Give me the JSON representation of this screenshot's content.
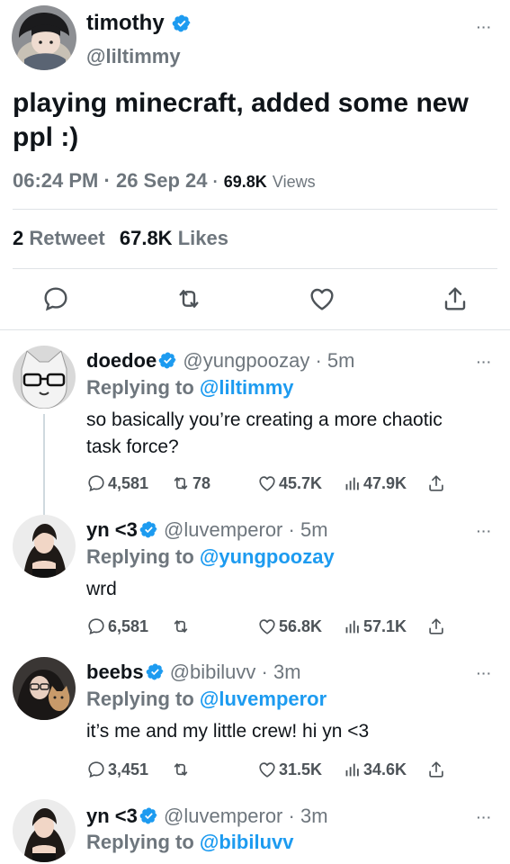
{
  "main_tweet": {
    "name": "timothy",
    "handle": "@liltimmy",
    "text": "playing minecraft, added some new ppl :)",
    "time": "06:24 PM",
    "separator": "·",
    "date": "26 Sep 24",
    "views_count": "69.8K",
    "views_label": "Views",
    "retweet_count": "2",
    "retweet_label": "Retweet",
    "like_count": "67.8K",
    "like_label": "Likes",
    "more_icon": "···"
  },
  "replies": [
    {
      "name": "doedoe",
      "handle": "@yungpoozay",
      "time": "· 5m",
      "replying_label": "Replying to",
      "replying_to": "@liltimmy",
      "text": "so basically you’re creating a more chaotic task force?",
      "comments": "4,581",
      "retweets": "78",
      "likes": "45.7K",
      "views": "47.9K"
    },
    {
      "name": "yn <3",
      "handle": "@luvemperor",
      "time": "· 5m",
      "replying_label": "Replying to",
      "replying_to": "@yungpoozay",
      "text": "wrd",
      "comments": "6,581",
      "retweets": "",
      "likes": "56.8K",
      "views": "57.1K"
    },
    {
      "name": "beebs",
      "handle": "@bibiluvv",
      "time": "· 3m",
      "replying_label": "Replying to",
      "replying_to": "@luvemperor",
      "text": "it’s me and my little crew! hi yn <3",
      "comments": "3,451",
      "retweets": "",
      "likes": "31.5K",
      "views": "34.6K"
    },
    {
      "name": "yn <3",
      "handle": "@luvemperor",
      "time": "· 3m",
      "replying_label": "Replying to",
      "replying_to": "@bibiluvv"
    }
  ],
  "colors": {
    "accent": "#1d9bf0",
    "secondary_text": "#6e767d",
    "divider": "#dfe3e6"
  },
  "icons": {
    "verified": "verified-badge-icon",
    "reply": "comment-icon",
    "retweet": "retweet-icon",
    "like": "heart-icon",
    "share": "share-icon",
    "views": "views-bar-chart-icon",
    "more": "more-options-icon"
  }
}
